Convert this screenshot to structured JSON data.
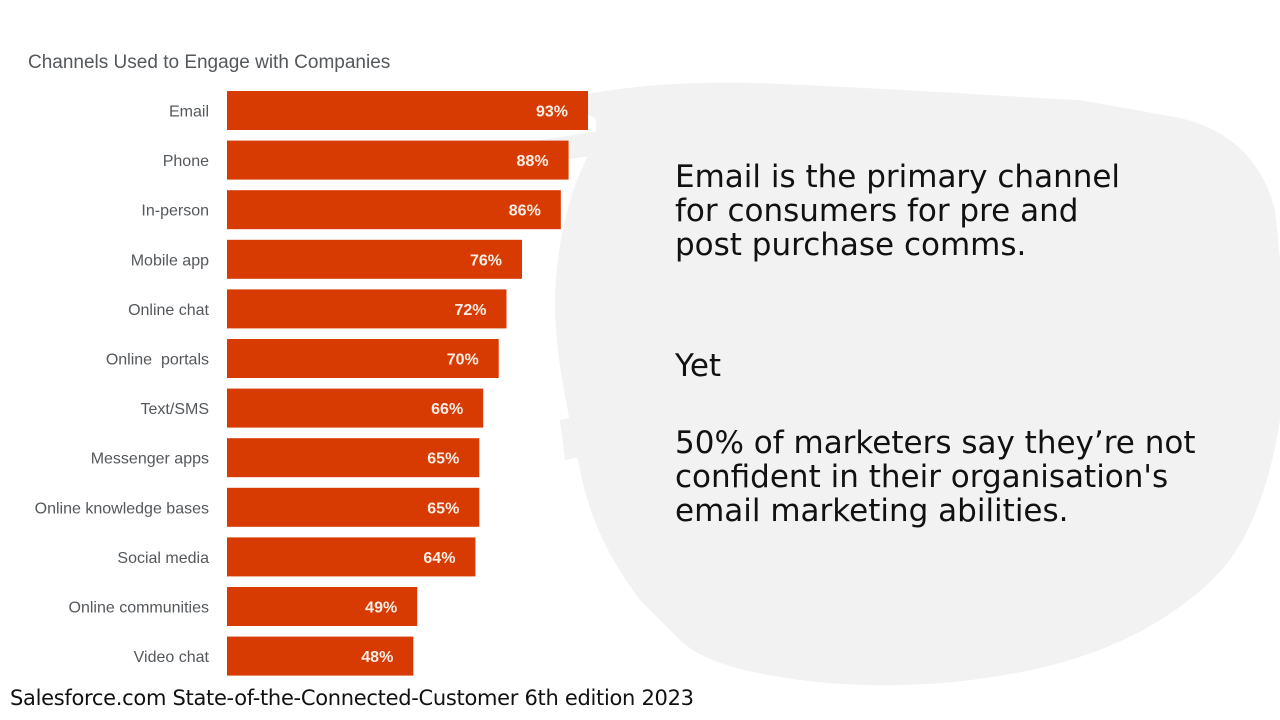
{
  "slide": {
    "callout_main": "Email is the primary channel\nfor consumers for pre and\npost purchase comms.",
    "callout_yet": "Yet",
    "callout_stat": "50% of marketers say they’re not\nconfident in their organisation's\nemail marketing abilities.",
    "source": "Salesforce.com State-of-the-Connected-Customer 6th edition 2023",
    "colors": {
      "bar": "#d83b01",
      "brush": "#f2f2f2"
    }
  },
  "chart_data": {
    "type": "bar",
    "orientation": "horizontal",
    "title": "Channels Used to Engage with Companies",
    "xlabel": "",
    "ylabel": "",
    "xlim": [
      0,
      100
    ],
    "grid": false,
    "categories": [
      "Email",
      "Phone",
      "In-person",
      "Mobile app",
      "Online chat",
      "Online  portals",
      "Text/SMS",
      "Messenger apps",
      "Online knowledge bases",
      "Social media",
      "Online communities",
      "Video chat"
    ],
    "values": [
      93,
      88,
      86,
      76,
      72,
      70,
      66,
      65,
      65,
      64,
      49,
      48
    ],
    "labels": [
      "93%",
      "88%",
      "86%",
      "76%",
      "72%",
      "70%",
      "66%",
      "65%",
      "65%",
      "64%",
      "49%",
      "48%"
    ]
  }
}
